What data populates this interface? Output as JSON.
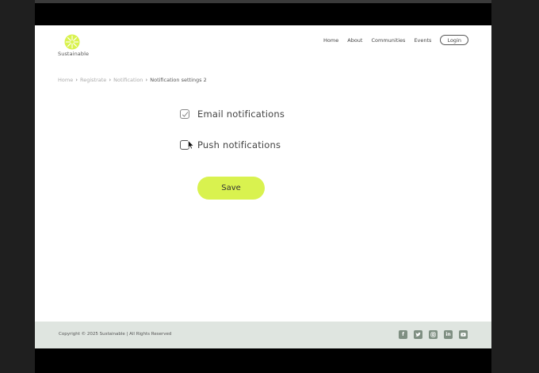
{
  "brand": {
    "name": "Sustainable",
    "accent": "#d9f24f"
  },
  "nav": {
    "items": [
      "Home",
      "About",
      "Communities",
      "Events"
    ],
    "login_label": "Login"
  },
  "breadcrumb": {
    "items": [
      "Home",
      "Registrate",
      "Notification"
    ],
    "current": "Notification settings 2"
  },
  "settings": {
    "email": {
      "label": "Email notifications",
      "checked": true
    },
    "push": {
      "label": "Push notifications",
      "checked": false
    },
    "save_label": "Save"
  },
  "footer": {
    "copyright": "Copyright © 2025 Sustainable | All Rights Reserved",
    "socials": [
      "facebook-icon",
      "twitter-icon",
      "instagram-icon",
      "linkedin-icon",
      "youtube-icon"
    ]
  }
}
